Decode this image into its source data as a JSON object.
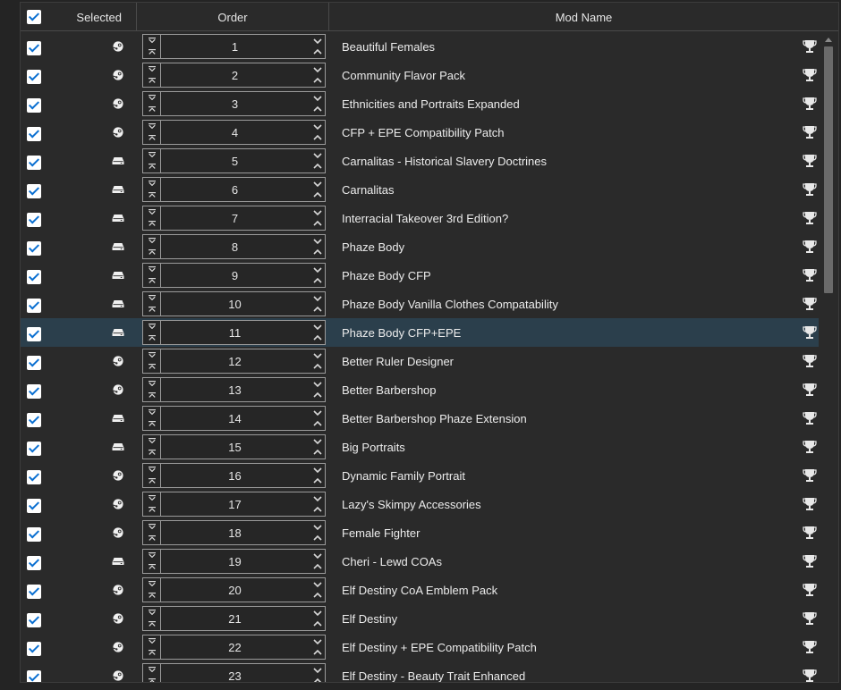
{
  "header": {
    "selected_label": "Selected",
    "order_label": "Order",
    "mod_name_label": "Mod Name",
    "select_all_checked": true
  },
  "colors": {
    "background": "#242424",
    "highlight_row": "#2b3f4c",
    "checkbox_check": "#0a6fd1"
  },
  "icons": {
    "steam": "steam-icon",
    "local": "local-drive-icon",
    "trophy": "trophy-icon"
  },
  "highlighted_row_index": 10,
  "rows": [
    {
      "order": "1",
      "name": "Beautiful Females",
      "source": "steam",
      "checked": true
    },
    {
      "order": "2",
      "name": "Community Flavor Pack",
      "source": "steam",
      "checked": true
    },
    {
      "order": "3",
      "name": "Ethnicities and Portraits Expanded",
      "source": "steam",
      "checked": true
    },
    {
      "order": "4",
      "name": "CFP + EPE Compatibility Patch",
      "source": "steam",
      "checked": true
    },
    {
      "order": "5",
      "name": "Carnalitas - Historical Slavery Doctrines",
      "source": "local",
      "checked": true
    },
    {
      "order": "6",
      "name": "Carnalitas",
      "source": "local",
      "checked": true
    },
    {
      "order": "7",
      "name": "Interracial Takeover 3rd Edition?",
      "source": "local",
      "checked": true
    },
    {
      "order": "8",
      "name": "Phaze Body",
      "source": "local",
      "checked": true
    },
    {
      "order": "9",
      "name": "Phaze Body CFP",
      "source": "local",
      "checked": true
    },
    {
      "order": "10",
      "name": "Phaze Body Vanilla Clothes Compatability",
      "source": "local",
      "checked": true
    },
    {
      "order": "11",
      "name": "Phaze Body CFP+EPE",
      "source": "local",
      "checked": true
    },
    {
      "order": "12",
      "name": "Better Ruler Designer",
      "source": "steam",
      "checked": true
    },
    {
      "order": "13",
      "name": "Better Barbershop",
      "source": "steam",
      "checked": true
    },
    {
      "order": "14",
      "name": "Better Barbershop Phaze Extension",
      "source": "local",
      "checked": true
    },
    {
      "order": "15",
      "name": "Big Portraits",
      "source": "local",
      "checked": true
    },
    {
      "order": "16",
      "name": "Dynamic Family Portrait",
      "source": "steam",
      "checked": true
    },
    {
      "order": "17",
      "name": "Lazy's Skimpy Accessories",
      "source": "steam",
      "checked": true
    },
    {
      "order": "18",
      "name": "Female Fighter",
      "source": "steam",
      "checked": true
    },
    {
      "order": "19",
      "name": "Cheri - Lewd COAs",
      "source": "local",
      "checked": true
    },
    {
      "order": "20",
      "name": "Elf Destiny CoA Emblem Pack",
      "source": "steam",
      "checked": true
    },
    {
      "order": "21",
      "name": "Elf Destiny",
      "source": "steam",
      "checked": true
    },
    {
      "order": "22",
      "name": "Elf Destiny + EPE Compatibility Patch",
      "source": "steam",
      "checked": true
    },
    {
      "order": "23",
      "name": "Elf Destiny - Beauty Trait Enhanced",
      "source": "steam",
      "checked": true
    }
  ]
}
